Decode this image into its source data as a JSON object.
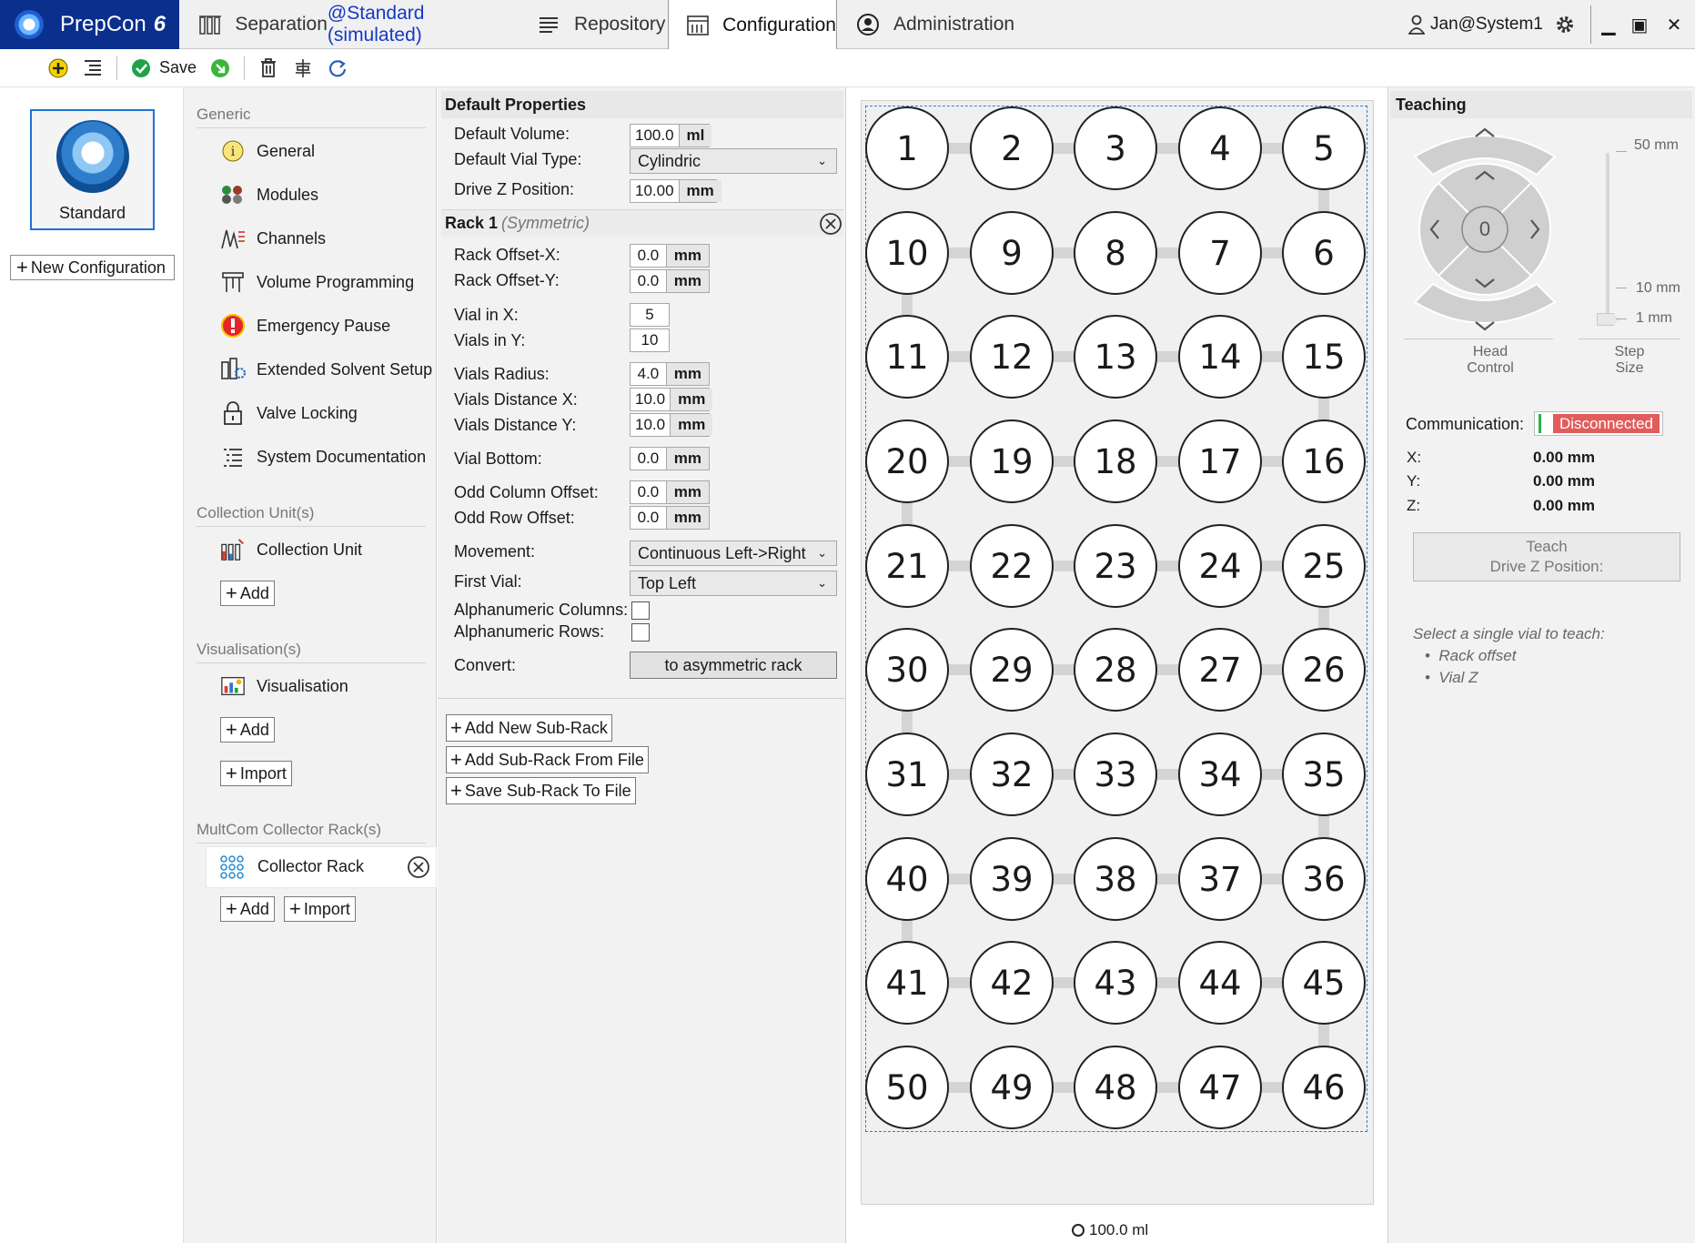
{
  "titlebar": {
    "app_name": "PrepCon",
    "app_version": "6",
    "tabs": [
      {
        "label_prefix": "Separation",
        "label_suffix": "@Standard (simulated)"
      },
      {
        "label": "Repository"
      },
      {
        "label": "Configuration"
      },
      {
        "label": "Administration"
      }
    ],
    "user": "Jan@System1"
  },
  "toolbar": {
    "save_label": "Save"
  },
  "left": {
    "configuration_name": "Standard",
    "new_configuration_label": "New Configuration"
  },
  "nav": {
    "generic_header": "Generic",
    "generic_items": [
      {
        "label": "General",
        "icon": "info-icon"
      },
      {
        "label": "Modules",
        "icon": "modules-icon"
      },
      {
        "label": "Channels",
        "icon": "channels-icon"
      },
      {
        "label": "Volume Programming",
        "icon": "volume-programming-icon"
      },
      {
        "label": "Emergency Pause",
        "icon": "emergency-icon"
      },
      {
        "label": "Extended Solvent Setup",
        "icon": "solvent-setup-icon"
      },
      {
        "label": "Valve Locking",
        "icon": "lock-icon"
      },
      {
        "label": "System Documentation",
        "icon": "documentation-icon"
      }
    ],
    "collection_header": "Collection Unit(s)",
    "collection_item": "Collection Unit",
    "visualisation_header": "Visualisation(s)",
    "visualisation_item": "Visualisation",
    "multcom_header": "MultCom Collector Rack(s)",
    "multcom_item": "Collector Rack",
    "add_label": "Add",
    "import_label": "Import"
  },
  "properties": {
    "default_header": "Default Properties",
    "default_volume_label": "Default Volume:",
    "default_volume_value": "100.0",
    "default_volume_unit": "ml",
    "default_vial_type_label": "Default Vial Type:",
    "default_vial_type_value": "Cylindric",
    "drive_z_label": "Drive Z Position:",
    "drive_z_value": "10.00",
    "drive_z_unit": "mm",
    "rack_title": "Rack 1",
    "rack_subtitle": "(Symmetric)",
    "rack_offset_x_label": "Rack Offset-X:",
    "rack_offset_x_value": "0.0",
    "rack_offset_y_label": "Rack Offset-Y:",
    "rack_offset_y_value": "0.0",
    "vial_in_x_label": "Vial in X:",
    "vial_in_x_value": "5",
    "vials_in_y_label": "Vials in Y:",
    "vials_in_y_value": "10",
    "vials_radius_label": "Vials Radius:",
    "vials_radius_value": "4.0",
    "vials_distance_x_label": "Vials Distance X:",
    "vials_distance_x_value": "10.0",
    "vials_distance_y_label": "Vials Distance Y:",
    "vials_distance_y_value": "10.0",
    "vial_bottom_label": "Vial Bottom:",
    "vial_bottom_value": "0.0",
    "odd_column_offset_label": "Odd Column Offset:",
    "odd_column_offset_value": "0.0",
    "odd_row_offset_label": "Odd Row Offset:",
    "odd_row_offset_value": "0.0",
    "unit_mm": "mm",
    "movement_label": "Movement:",
    "movement_value": "Continuous Left->Right",
    "first_vial_label": "First Vial:",
    "first_vial_value": "Top Left",
    "alpha_columns_label": "Alphanumeric Columns:",
    "alpha_rows_label": "Alphanumeric Rows:",
    "convert_label": "Convert:",
    "convert_button": "to asymmetric rack",
    "add_sub_rack": "Add New Sub-Rack",
    "add_sub_rack_file": "Add Sub-Rack From File",
    "save_sub_rack_file": "Save Sub-Rack To File"
  },
  "rack": {
    "rows": [
      [
        "1",
        "2",
        "3",
        "4",
        "5"
      ],
      [
        "10",
        "9",
        "8",
        "7",
        "6"
      ],
      [
        "11",
        "12",
        "13",
        "14",
        "15"
      ],
      [
        "20",
        "19",
        "18",
        "17",
        "16"
      ],
      [
        "21",
        "22",
        "23",
        "24",
        "25"
      ],
      [
        "30",
        "29",
        "28",
        "27",
        "26"
      ],
      [
        "31",
        "32",
        "33",
        "34",
        "35"
      ],
      [
        "40",
        "39",
        "38",
        "37",
        "36"
      ],
      [
        "41",
        "42",
        "43",
        "44",
        "45"
      ],
      [
        "50",
        "49",
        "48",
        "47",
        "46"
      ]
    ],
    "volume_footer": "100.0 ml"
  },
  "teaching": {
    "header": "Teaching",
    "center_value": "0",
    "step_50": "50 mm",
    "step_10": "10 mm",
    "step_1": "1 mm",
    "head_control_label_1": "Head",
    "head_control_label_2": "Control",
    "step_size_label_1": "Step",
    "step_size_label_2": "Size",
    "communication_label": "Communication:",
    "communication_status": "Disconnected",
    "x_label": "X:",
    "x_value": "0.00 mm",
    "y_label": "Y:",
    "y_value": "0.00 mm",
    "z_label": "Z:",
    "z_value": "0.00 mm",
    "teach_button_line1": "Teach",
    "teach_button_line2": "Drive Z Position:",
    "hint_title": "Select a single vial to teach:",
    "hint_items": [
      "Rack offset",
      "Vial Z"
    ]
  },
  "colors": {
    "brand": "#0a2f8c",
    "accent_blue": "#1439c8",
    "selection": "#1e73d2",
    "disconnected": "#e25c5c"
  }
}
